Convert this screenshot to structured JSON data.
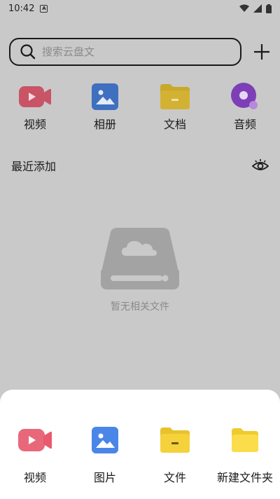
{
  "status": {
    "time": "10:42",
    "notif": "A"
  },
  "search": {
    "placeholder": "搜索云盘文"
  },
  "categories": [
    {
      "label": "视频",
      "icon": "video-icon"
    },
    {
      "label": "相册",
      "icon": "photo-icon"
    },
    {
      "label": "文档",
      "icon": "folder-icon"
    },
    {
      "label": "音频",
      "icon": "music-disc-icon"
    }
  ],
  "recent": {
    "title": "最近添加"
  },
  "empty": {
    "text": "暂无相关文件"
  },
  "sheet": {
    "items": [
      {
        "label": "视频",
        "icon": "video-icon"
      },
      {
        "label": "图片",
        "icon": "photo-icon"
      },
      {
        "label": "文件",
        "icon": "file-folder-icon"
      },
      {
        "label": "新建文件夹",
        "icon": "new-folder-icon"
      }
    ]
  },
  "colors": {
    "overlay_bg": "#c9c9c9",
    "video_red": "#e85a6c",
    "photo_blue": "#4a86e8",
    "folder_yellow": "#f5d23c",
    "music_purple": "#9a52d8"
  }
}
